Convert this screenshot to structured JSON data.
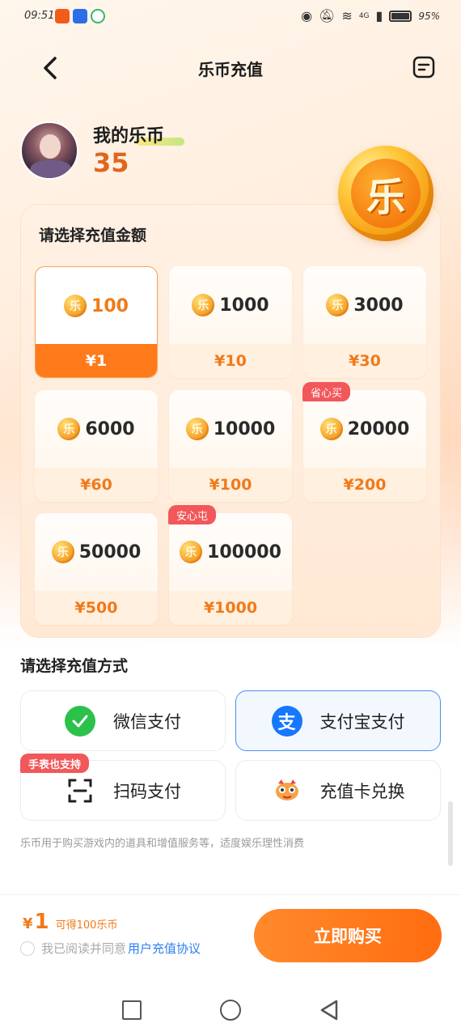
{
  "status_bar": {
    "time": "09:51",
    "battery": "95%",
    "network": "4G"
  },
  "header": {
    "title": "乐币充值"
  },
  "user": {
    "coin_title": "我的乐币",
    "balance": "35"
  },
  "big_coin_char": "乐",
  "amount_section": {
    "title": "请选择充值金额",
    "coin_char": "乐",
    "packages": [
      {
        "amount": "100",
        "price": "¥1",
        "badge": "",
        "selected": true
      },
      {
        "amount": "1000",
        "price": "¥10",
        "badge": ""
      },
      {
        "amount": "3000",
        "price": "¥30",
        "badge": ""
      },
      {
        "amount": "6000",
        "price": "¥60",
        "badge": ""
      },
      {
        "amount": "10000",
        "price": "¥100",
        "badge": ""
      },
      {
        "amount": "20000",
        "price": "¥200",
        "badge": "省心买"
      },
      {
        "amount": "50000",
        "price": "¥500",
        "badge": ""
      },
      {
        "amount": "100000",
        "price": "¥1000",
        "badge": "安心屯"
      }
    ]
  },
  "payment_section": {
    "title": "请选择充值方式",
    "methods": [
      {
        "label": "微信支付",
        "icon": "wechat-pay-icon"
      },
      {
        "label": "支付宝支付",
        "icon": "alipay-icon",
        "selected": true
      },
      {
        "label": "扫码支付",
        "icon": "scan-icon",
        "badge": "手表也支持"
      },
      {
        "label": "充值卡兑换",
        "icon": "recharge-card-icon"
      }
    ],
    "alipay_char": "支",
    "note": "乐币用于购买游戏内的道具和增值服务等，适度娱乐理性消费"
  },
  "footer": {
    "currency_symbol": "¥",
    "price_value": "1",
    "price_desc": "可得100乐币",
    "agree_text": "我已阅读并同意",
    "agree_link": "用户充值协议",
    "buy_label": "立即购买"
  },
  "colors": {
    "accent": "#ff7a1a",
    "badge": "#f2575a",
    "link": "#2d7ff0",
    "wechat": "#2bc14a",
    "alipay": "#1677ff"
  }
}
